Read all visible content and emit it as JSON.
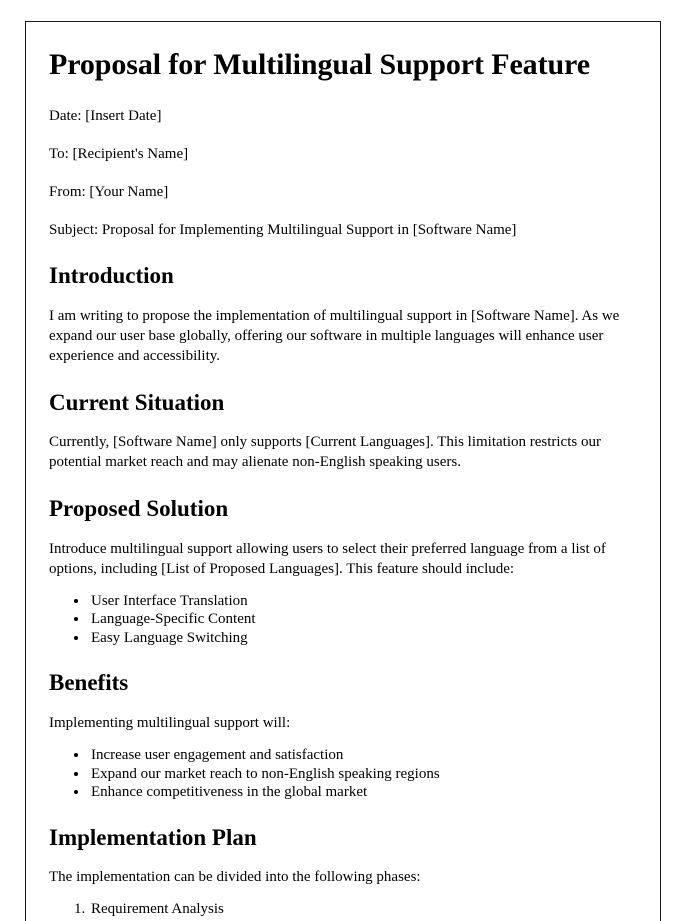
{
  "document": {
    "title": "Proposal for Multilingual Support Feature",
    "meta": [
      "Date: [Insert Date]",
      "To: [Recipient's Name]",
      "From: [Your Name]",
      "Subject: Proposal for Implementing Multilingual Support in [Software Name]"
    ],
    "sections": {
      "introduction": {
        "heading": "Introduction",
        "paragraph": "I am writing to propose the implementation of multilingual support in [Software Name]. As we expand our user base globally, offering our software in multiple languages will enhance user experience and accessibility."
      },
      "current_situation": {
        "heading": "Current Situation",
        "paragraph": "Currently, [Software Name] only supports [Current Languages]. This limitation restricts our potential market reach and may alienate non-English speaking users."
      },
      "proposed_solution": {
        "heading": "Proposed Solution",
        "paragraph": "Introduce multilingual support allowing users to select their preferred language from a list of options, including [List of Proposed Languages]. This feature should include:",
        "bullets": [
          "User Interface Translation",
          "Language-Specific Content",
          "Easy Language Switching"
        ]
      },
      "benefits": {
        "heading": "Benefits",
        "paragraph": "Implementing multilingual support will:",
        "bullets": [
          "Increase user engagement and satisfaction",
          "Expand our market reach to non-English speaking regions",
          "Enhance competitiveness in the global market"
        ]
      },
      "implementation_plan": {
        "heading": "Implementation Plan",
        "paragraph": "The implementation can be divided into the following phases:",
        "steps": [
          "Requirement Analysis"
        ]
      }
    }
  },
  "colors": {
    "page_border": "#1b1b1b",
    "text": "#000000",
    "background": "#ffffff"
  }
}
